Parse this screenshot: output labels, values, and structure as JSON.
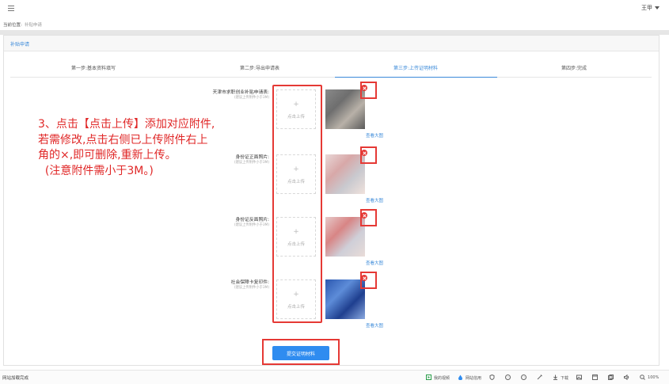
{
  "header": {
    "user_name": "王甲"
  },
  "breadcrumb": {
    "label": "当前位置:",
    "current": "补贴申请"
  },
  "panel": {
    "title": "补贴申请"
  },
  "steps": [
    {
      "label": "第一步:基本资料填写",
      "active": false
    },
    {
      "label": "第二步:导出申请表",
      "active": false
    },
    {
      "label": "第三步:上传证明材料",
      "active": true
    },
    {
      "label": "第四步:完成",
      "active": false
    }
  ],
  "upload_fields": [
    {
      "label": "天津市求职创业补贴申请表:",
      "hint": "(建议上传附件小于3M)",
      "upload_label": "点击上传",
      "view_label": "查看大图",
      "thumb_colors": [
        "#8a8a8a",
        "#6e6e6e",
        "#b8b1a8",
        "#5a5a5a"
      ]
    },
    {
      "label": "身份证正面照片:",
      "hint": "(建议上传附件小于3M)",
      "upload_label": "点击上传",
      "view_label": "查看大图",
      "thumb_colors": [
        "#e9d7d7",
        "#d8a8a8",
        "#c9c9cf",
        "#f0e2dc"
      ]
    },
    {
      "label": "身份证反面照片:",
      "hint": "(建议上传附件小于3M)",
      "upload_label": "点击上传",
      "view_label": "查看大图",
      "thumb_colors": [
        "#e6c9c9",
        "#d88585",
        "#cfcfd8",
        "#e9dcd8"
      ]
    },
    {
      "label": "社会保障卡复印件:",
      "hint": "(建议上传附件小于3M)",
      "upload_label": "点击上传",
      "view_label": "查看大图",
      "thumb_colors": [
        "#2c58b0",
        "#5d8cd8",
        "#1f3f8f",
        "#8aa9e0"
      ]
    }
  ],
  "instruction": {
    "lines": [
      "3、点击【点击上传】添加对应附件,",
      "若需修改,点击右侧已上传附件右上",
      "角的×,即可删除,重新上传。",
      "  (注意附件需小于3M。)"
    ]
  },
  "submit": {
    "label": "提交证明材料"
  },
  "statusbar": {
    "left_text": "网站加载完成",
    "items": [
      {
        "icon": "video-icon",
        "label": "我的视频"
      },
      {
        "icon": "water-drop-icon",
        "label": "网站信用"
      },
      {
        "icon": "shield-icon",
        "label": ""
      },
      {
        "icon": "emoji-icon",
        "label": ""
      },
      {
        "icon": "emoji-icon",
        "label": ""
      },
      {
        "icon": "magic-icon",
        "label": ""
      },
      {
        "icon": "download-icon",
        "label": "下载"
      },
      {
        "icon": "image-icon",
        "label": ""
      },
      {
        "icon": "window-icon",
        "label": ""
      },
      {
        "icon": "copy-icon",
        "label": ""
      },
      {
        "icon": "speaker-icon",
        "label": ""
      },
      {
        "icon": "zoom-icon",
        "label": "100%"
      }
    ]
  },
  "colors": {
    "accent": "#3b8ad9",
    "annotation_red": "#e53935",
    "instruction_red": "#e02828",
    "submit_blue": "#2f8cf0"
  }
}
